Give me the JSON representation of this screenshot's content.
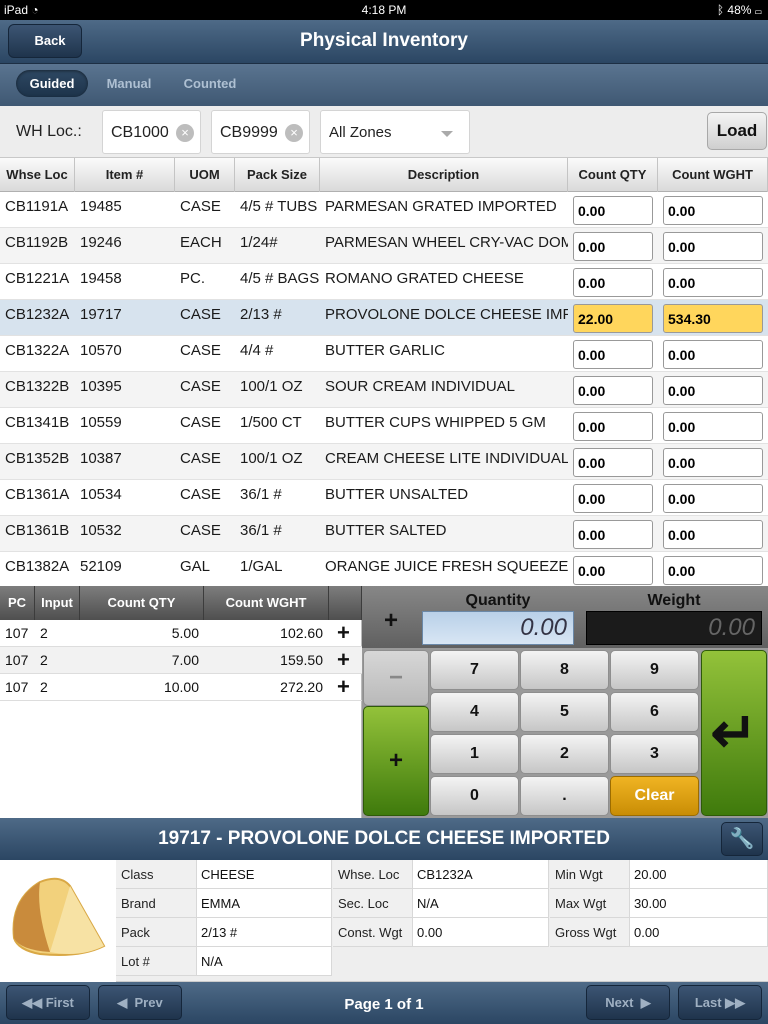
{
  "status": {
    "device": "iPad",
    "time": "4:18 PM",
    "battery": "48%"
  },
  "nav": {
    "back": "Back",
    "title": "Physical Inventory"
  },
  "tabs": [
    "Guided",
    "Manual",
    "Counted"
  ],
  "filter": {
    "label": "WH Loc.:",
    "from": "CB1000",
    "to": "CB9999",
    "zone": "All Zones",
    "load": "Load"
  },
  "columns": [
    "Whse Loc",
    "Item #",
    "UOM",
    "Pack Size",
    "Description",
    "Count QTY",
    "Count WGHT"
  ],
  "rows": [
    [
      "CB1191A",
      "19485",
      "CASE",
      "4/5 # TUBS",
      "PARMESAN GRATED IMPORTED",
      "0.00",
      "0.00"
    ],
    [
      "CB1192B",
      "19246",
      "EACH",
      "1/24#",
      "PARMESAN WHEEL CRY-VAC DOM",
      "0.00",
      "0.00"
    ],
    [
      "CB1221A",
      "19458",
      "PC.",
      "4/5 # BAGS",
      "ROMANO GRATED CHEESE",
      "0.00",
      "0.00"
    ],
    [
      "CB1232A",
      "19717",
      "CASE",
      "2/13 #",
      "PROVOLONE DOLCE CHEESE IMPORTED",
      "22.00",
      "534.30"
    ],
    [
      "CB1322A",
      "10570",
      "CASE",
      "4/4 #",
      "BUTTER GARLIC",
      "0.00",
      "0.00"
    ],
    [
      "CB1322B",
      "10395",
      "CASE",
      "100/1 OZ",
      "SOUR CREAM INDIVIDUAL",
      "0.00",
      "0.00"
    ],
    [
      "CB1341B",
      "10559",
      "CASE",
      "1/500 CT",
      "BUTTER CUPS WHIPPED 5 GM",
      "0.00",
      "0.00"
    ],
    [
      "CB1352B",
      "10387",
      "CASE",
      "100/1 OZ",
      "CREAM CHEESE LITE INDIVIDUAL",
      "0.00",
      "0.00"
    ],
    [
      "CB1361A",
      "10534",
      "CASE",
      "36/1 #",
      "BUTTER UNSALTED",
      "0.00",
      "0.00"
    ],
    [
      "CB1361B",
      "10532",
      "CASE",
      "36/1 #",
      "BUTTER SALTED",
      "0.00",
      "0.00"
    ],
    [
      "CB1382A",
      "52109",
      "GAL",
      "1/GAL",
      "ORANGE JUICE FRESH SQUEEZED",
      "0.00",
      "0.00"
    ]
  ],
  "selected_row": 3,
  "sub": {
    "columns": [
      "PC",
      "Input",
      "Count QTY",
      "Count WGHT"
    ],
    "rows": [
      [
        "107",
        "2",
        "5.00",
        "102.60"
      ],
      [
        "107",
        "2",
        "7.00",
        "159.50"
      ],
      [
        "107",
        "2",
        "10.00",
        "272.20"
      ]
    ]
  },
  "keypad": {
    "quantity_label": "Quantity",
    "weight_label": "Weight",
    "quantity": "0.00",
    "weight": "0.00",
    "plus": "+",
    "minus": "−",
    "enter": "↵",
    "keys": [
      "7",
      "8",
      "9",
      "4",
      "5",
      "6",
      "1",
      "2",
      "3",
      "0",
      ".",
      "Clear"
    ]
  },
  "detail": {
    "title": "19717 - PROVOLONE DOLCE CHEESE IMPORTED",
    "class_label": "Class",
    "class": "CHEESE",
    "brand_label": "Brand",
    "brand": "EMMA",
    "pack_label": "Pack",
    "pack": "2/13 #",
    "lot_label": "Lot #",
    "lot": "N/A",
    "whse_label": "Whse. Loc",
    "whse": "CB1232A",
    "sec_label": "Sec. Loc",
    "sec": "N/A",
    "const_label": "Const. Wgt",
    "const": "0.00",
    "min_label": "Min Wgt",
    "min": "20.00",
    "max_label": "Max Wgt",
    "max": "30.00",
    "gross_label": "Gross Wgt",
    "gross": "0.00"
  },
  "pager": {
    "first": "First",
    "prev": "Prev",
    "page": "Page 1 of 1",
    "next": "Next",
    "last": "Last"
  }
}
